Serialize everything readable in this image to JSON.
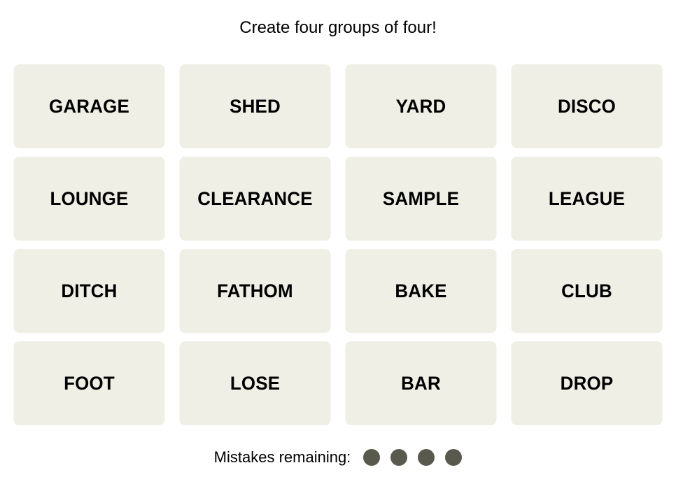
{
  "prompt": "Create four groups of four!",
  "tiles": [
    {
      "label": "GARAGE"
    },
    {
      "label": "SHED"
    },
    {
      "label": "YARD"
    },
    {
      "label": "DISCO"
    },
    {
      "label": "LOUNGE"
    },
    {
      "label": "CLEARANCE"
    },
    {
      "label": "SAMPLE"
    },
    {
      "label": "LEAGUE"
    },
    {
      "label": "DITCH"
    },
    {
      "label": "FATHOM"
    },
    {
      "label": "BAKE"
    },
    {
      "label": "CLUB"
    },
    {
      "label": "FOOT"
    },
    {
      "label": "LOSE"
    },
    {
      "label": "BAR"
    },
    {
      "label": "DROP"
    }
  ],
  "mistakes": {
    "label": "Mistakes remaining:",
    "remaining": 4,
    "dot_color": "#5a594e"
  },
  "colors": {
    "tile_background": "#efefe6",
    "tile_text": "#000000"
  }
}
